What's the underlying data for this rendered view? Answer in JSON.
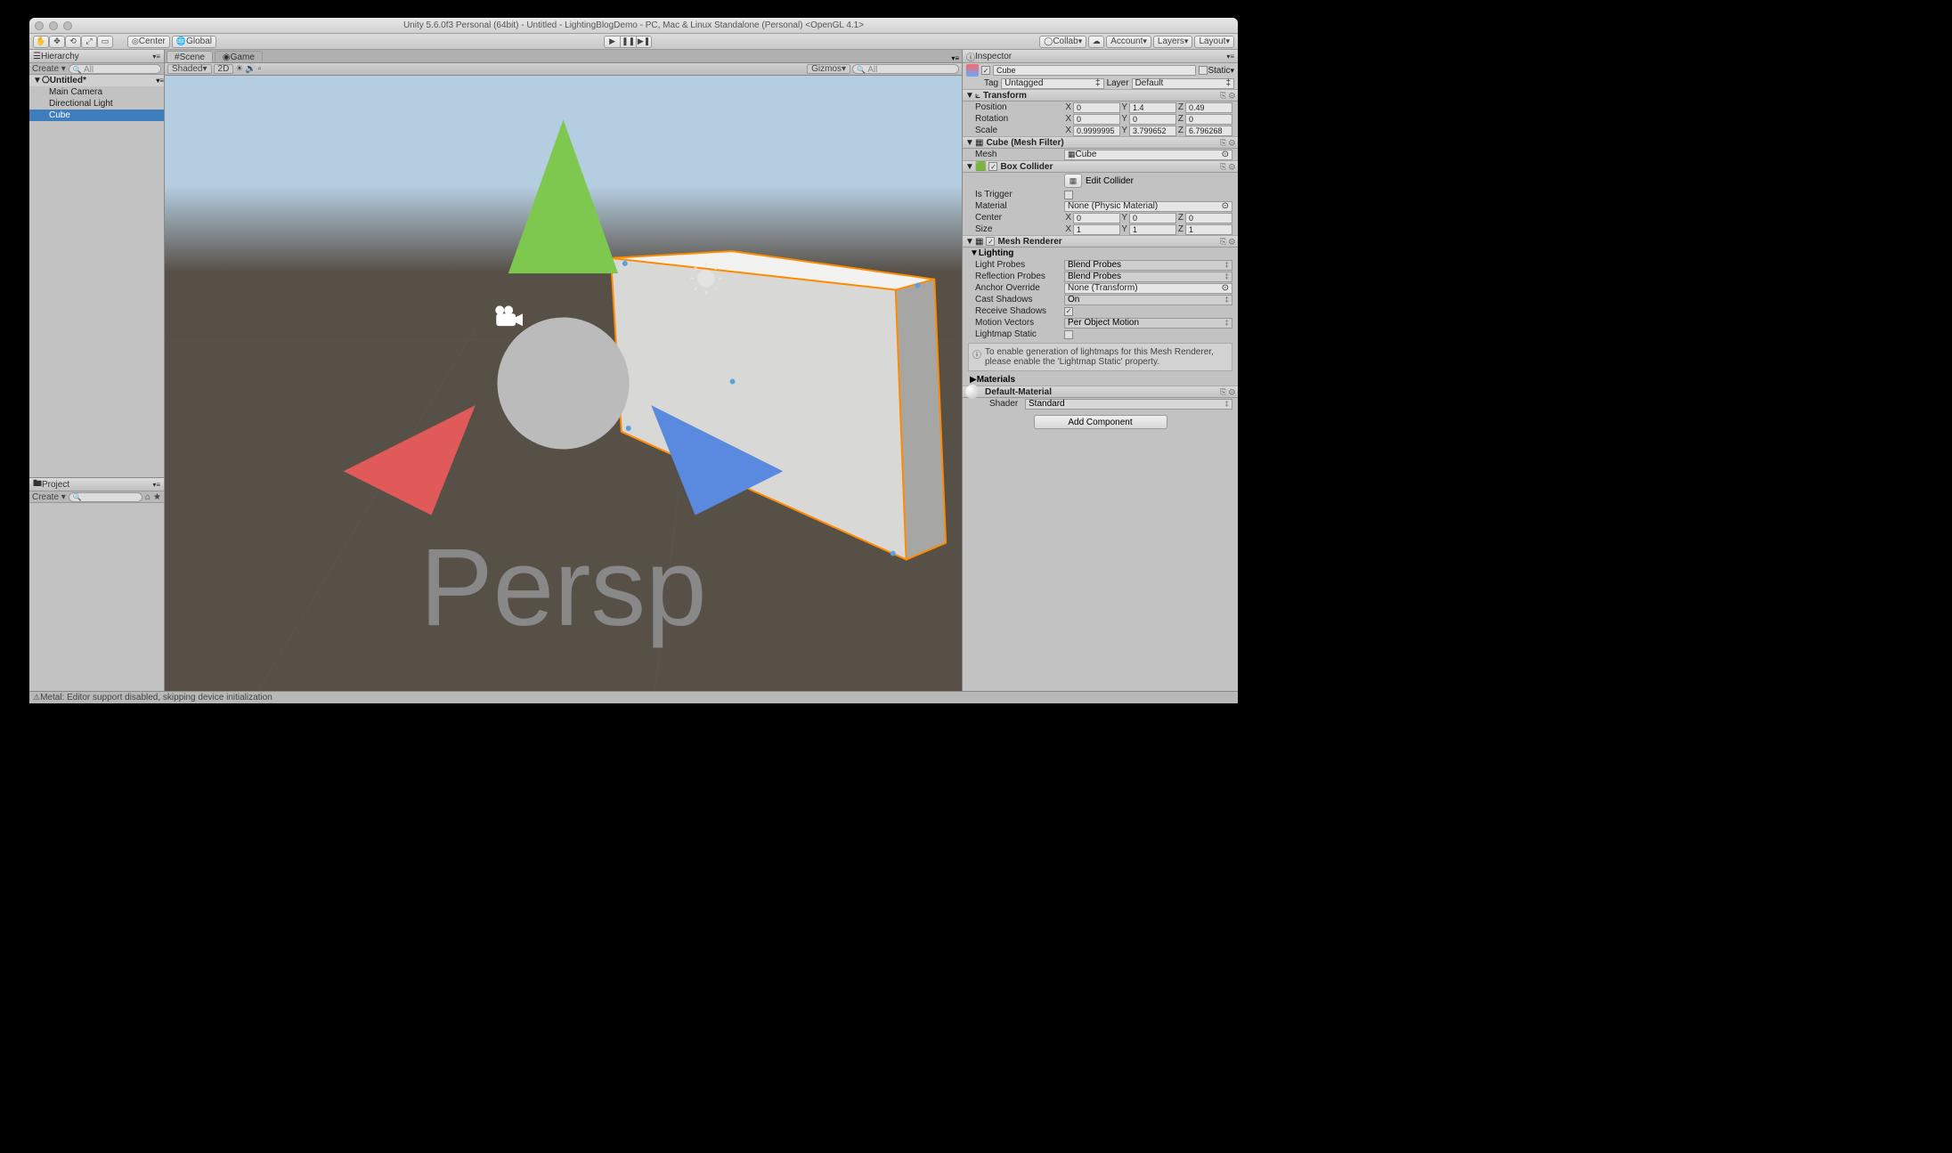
{
  "window": {
    "title": "Unity 5.6.0f3 Personal (64bit) - Untitled - LightingBlogDemo - PC, Mac & Linux Standalone (Personal) <OpenGL 4.1>"
  },
  "toolbar": {
    "center": "Center",
    "global": "Global",
    "collab": "Collab",
    "account": "Account",
    "layers": "Layers",
    "layout": "Layout"
  },
  "hierarchy": {
    "title": "Hierarchy",
    "create": "Create",
    "search_ph": "All",
    "scene": "Untitled*",
    "items": [
      "Main Camera",
      "Directional Light",
      "Cube"
    ],
    "selected": 2
  },
  "project": {
    "title": "Project",
    "create": "Create"
  },
  "scene": {
    "tab_scene": "Scene",
    "tab_game": "Game",
    "shade": "Shaded",
    "mode2d": "2D",
    "gizmos": "Gizmos",
    "search_ph": "All"
  },
  "inspector": {
    "title": "Inspector",
    "name": "Cube",
    "static": "Static",
    "tag_lbl": "Tag",
    "tag": "Untagged",
    "layer_lbl": "Layer",
    "layer": "Default",
    "transform": {
      "title": "Transform",
      "pos_lbl": "Position",
      "pos": {
        "x": "0",
        "y": "1.4",
        "z": "0.49"
      },
      "rot_lbl": "Rotation",
      "rot": {
        "x": "0",
        "y": "0",
        "z": "0"
      },
      "scl_lbl": "Scale",
      "scl": {
        "x": "0.9999995",
        "y": "3.799652",
        "z": "6.796268"
      }
    },
    "meshfilter": {
      "title": "Cube (Mesh Filter)",
      "mesh_lbl": "Mesh",
      "mesh": "Cube"
    },
    "boxcollider": {
      "title": "Box Collider",
      "edit": "Edit Collider",
      "trigger_lbl": "Is Trigger",
      "material_lbl": "Material",
      "material": "None (Physic Material)",
      "center_lbl": "Center",
      "center": {
        "x": "0",
        "y": "0",
        "z": "0"
      },
      "size_lbl": "Size",
      "size": {
        "x": "1",
        "y": "1",
        "z": "1"
      }
    },
    "meshrenderer": {
      "title": "Mesh Renderer",
      "lighting": "Lighting",
      "light_probes_lbl": "Light Probes",
      "light_probes": "Blend Probes",
      "refl_probes_lbl": "Reflection Probes",
      "refl_probes": "Blend Probes",
      "anchor_lbl": "Anchor Override",
      "anchor": "None (Transform)",
      "cast_lbl": "Cast Shadows",
      "cast": "On",
      "recv_lbl": "Receive Shadows",
      "motion_lbl": "Motion Vectors",
      "motion": "Per Object Motion",
      "lmstatic_lbl": "Lightmap Static",
      "info": "To enable generation of lightmaps for this Mesh Renderer, please enable the 'Lightmap Static' property.",
      "materials": "Materials"
    },
    "material": {
      "name": "Default-Material",
      "shader_lbl": "Shader",
      "shader": "Standard"
    },
    "add_component": "Add Component"
  },
  "status": "Metal: Editor support disabled, skipping device initialization"
}
